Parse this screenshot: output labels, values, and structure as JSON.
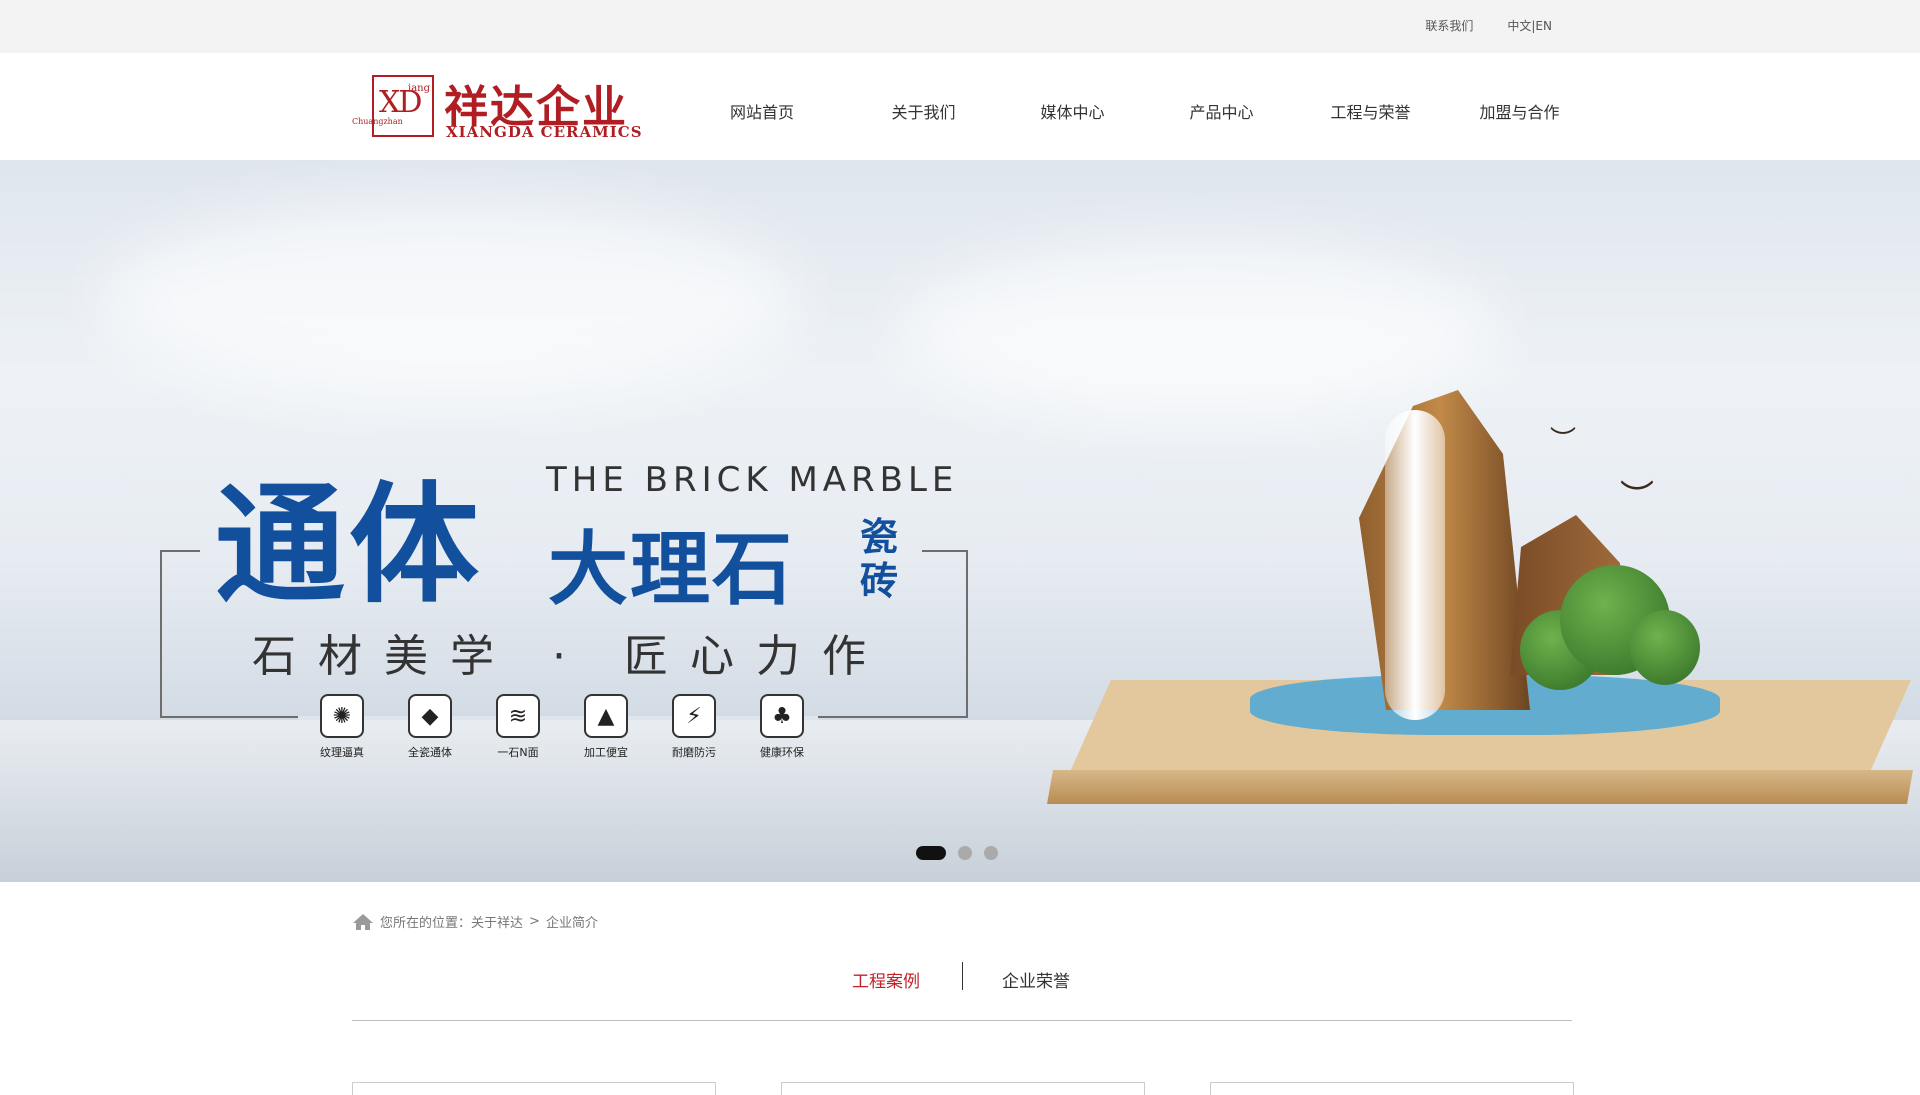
{
  "topbar": {
    "contact": "联系我们",
    "lang": "中文|EN"
  },
  "logo": {
    "mark": "XD",
    "mark_small": "iang",
    "side": "Chuangzhan",
    "cn": "祥达企业",
    "en": "XIANGDA CERAMICS"
  },
  "nav": [
    "网站首页",
    "关于我们",
    "媒体中心",
    "产品中心",
    "工程与荣誉",
    "加盟与合作"
  ],
  "banner": {
    "big": "通体",
    "english": "THE BRICK MARBLE",
    "main": "大理石",
    "small": "瓷砖",
    "tagline": "石材美学 · 匠心力作",
    "features": [
      {
        "icon": "✺",
        "label": "纹理逼真"
      },
      {
        "icon": "◆",
        "label": "全瓷通体"
      },
      {
        "icon": "≋",
        "label": "一石N面"
      },
      {
        "icon": "▲",
        "label": "加工便宜"
      },
      {
        "icon": "⚡",
        "label": "耐磨防污"
      },
      {
        "icon": "♣",
        "label": "健康环保"
      }
    ],
    "slides": 3
  },
  "breadcrumb": {
    "prefix": "您所在的位置：",
    "level1": "关于祥达",
    "sep": ">",
    "level2": "企业简介"
  },
  "tabs": {
    "cases": "工程案例",
    "honor": "企业荣誉"
  },
  "colors": {
    "brand_red": "#b01e23",
    "active_tab": "#c0212a",
    "banner_blue": "#124f9c"
  }
}
